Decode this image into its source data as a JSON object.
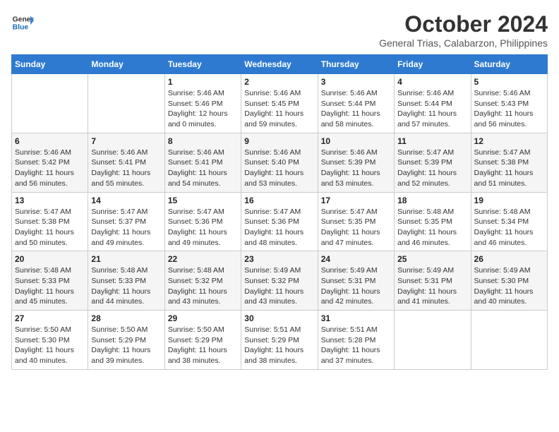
{
  "logo": {
    "text_general": "General",
    "text_blue": "Blue"
  },
  "header": {
    "month": "October 2024",
    "location": "General Trias, Calabarzon, Philippines"
  },
  "weekdays": [
    "Sunday",
    "Monday",
    "Tuesday",
    "Wednesday",
    "Thursday",
    "Friday",
    "Saturday"
  ],
  "weeks": [
    [
      {
        "day": "",
        "sunrise": "",
        "sunset": "",
        "daylight": ""
      },
      {
        "day": "",
        "sunrise": "",
        "sunset": "",
        "daylight": ""
      },
      {
        "day": "1",
        "sunrise": "Sunrise: 5:46 AM",
        "sunset": "Sunset: 5:46 PM",
        "daylight": "Daylight: 12 hours and 0 minutes."
      },
      {
        "day": "2",
        "sunrise": "Sunrise: 5:46 AM",
        "sunset": "Sunset: 5:45 PM",
        "daylight": "Daylight: 11 hours and 59 minutes."
      },
      {
        "day": "3",
        "sunrise": "Sunrise: 5:46 AM",
        "sunset": "Sunset: 5:44 PM",
        "daylight": "Daylight: 11 hours and 58 minutes."
      },
      {
        "day": "4",
        "sunrise": "Sunrise: 5:46 AM",
        "sunset": "Sunset: 5:44 PM",
        "daylight": "Daylight: 11 hours and 57 minutes."
      },
      {
        "day": "5",
        "sunrise": "Sunrise: 5:46 AM",
        "sunset": "Sunset: 5:43 PM",
        "daylight": "Daylight: 11 hours and 56 minutes."
      }
    ],
    [
      {
        "day": "6",
        "sunrise": "Sunrise: 5:46 AM",
        "sunset": "Sunset: 5:42 PM",
        "daylight": "Daylight: 11 hours and 56 minutes."
      },
      {
        "day": "7",
        "sunrise": "Sunrise: 5:46 AM",
        "sunset": "Sunset: 5:41 PM",
        "daylight": "Daylight: 11 hours and 55 minutes."
      },
      {
        "day": "8",
        "sunrise": "Sunrise: 5:46 AM",
        "sunset": "Sunset: 5:41 PM",
        "daylight": "Daylight: 11 hours and 54 minutes."
      },
      {
        "day": "9",
        "sunrise": "Sunrise: 5:46 AM",
        "sunset": "Sunset: 5:40 PM",
        "daylight": "Daylight: 11 hours and 53 minutes."
      },
      {
        "day": "10",
        "sunrise": "Sunrise: 5:46 AM",
        "sunset": "Sunset: 5:39 PM",
        "daylight": "Daylight: 11 hours and 53 minutes."
      },
      {
        "day": "11",
        "sunrise": "Sunrise: 5:47 AM",
        "sunset": "Sunset: 5:39 PM",
        "daylight": "Daylight: 11 hours and 52 minutes."
      },
      {
        "day": "12",
        "sunrise": "Sunrise: 5:47 AM",
        "sunset": "Sunset: 5:38 PM",
        "daylight": "Daylight: 11 hours and 51 minutes."
      }
    ],
    [
      {
        "day": "13",
        "sunrise": "Sunrise: 5:47 AM",
        "sunset": "Sunset: 5:38 PM",
        "daylight": "Daylight: 11 hours and 50 minutes."
      },
      {
        "day": "14",
        "sunrise": "Sunrise: 5:47 AM",
        "sunset": "Sunset: 5:37 PM",
        "daylight": "Daylight: 11 hours and 49 minutes."
      },
      {
        "day": "15",
        "sunrise": "Sunrise: 5:47 AM",
        "sunset": "Sunset: 5:36 PM",
        "daylight": "Daylight: 11 hours and 49 minutes."
      },
      {
        "day": "16",
        "sunrise": "Sunrise: 5:47 AM",
        "sunset": "Sunset: 5:36 PM",
        "daylight": "Daylight: 11 hours and 48 minutes."
      },
      {
        "day": "17",
        "sunrise": "Sunrise: 5:47 AM",
        "sunset": "Sunset: 5:35 PM",
        "daylight": "Daylight: 11 hours and 47 minutes."
      },
      {
        "day": "18",
        "sunrise": "Sunrise: 5:48 AM",
        "sunset": "Sunset: 5:35 PM",
        "daylight": "Daylight: 11 hours and 46 minutes."
      },
      {
        "day": "19",
        "sunrise": "Sunrise: 5:48 AM",
        "sunset": "Sunset: 5:34 PM",
        "daylight": "Daylight: 11 hours and 46 minutes."
      }
    ],
    [
      {
        "day": "20",
        "sunrise": "Sunrise: 5:48 AM",
        "sunset": "Sunset: 5:33 PM",
        "daylight": "Daylight: 11 hours and 45 minutes."
      },
      {
        "day": "21",
        "sunrise": "Sunrise: 5:48 AM",
        "sunset": "Sunset: 5:33 PM",
        "daylight": "Daylight: 11 hours and 44 minutes."
      },
      {
        "day": "22",
        "sunrise": "Sunrise: 5:48 AM",
        "sunset": "Sunset: 5:32 PM",
        "daylight": "Daylight: 11 hours and 43 minutes."
      },
      {
        "day": "23",
        "sunrise": "Sunrise: 5:49 AM",
        "sunset": "Sunset: 5:32 PM",
        "daylight": "Daylight: 11 hours and 43 minutes."
      },
      {
        "day": "24",
        "sunrise": "Sunrise: 5:49 AM",
        "sunset": "Sunset: 5:31 PM",
        "daylight": "Daylight: 11 hours and 42 minutes."
      },
      {
        "day": "25",
        "sunrise": "Sunrise: 5:49 AM",
        "sunset": "Sunset: 5:31 PM",
        "daylight": "Daylight: 11 hours and 41 minutes."
      },
      {
        "day": "26",
        "sunrise": "Sunrise: 5:49 AM",
        "sunset": "Sunset: 5:30 PM",
        "daylight": "Daylight: 11 hours and 40 minutes."
      }
    ],
    [
      {
        "day": "27",
        "sunrise": "Sunrise: 5:50 AM",
        "sunset": "Sunset: 5:30 PM",
        "daylight": "Daylight: 11 hours and 40 minutes."
      },
      {
        "day": "28",
        "sunrise": "Sunrise: 5:50 AM",
        "sunset": "Sunset: 5:29 PM",
        "daylight": "Daylight: 11 hours and 39 minutes."
      },
      {
        "day": "29",
        "sunrise": "Sunrise: 5:50 AM",
        "sunset": "Sunset: 5:29 PM",
        "daylight": "Daylight: 11 hours and 38 minutes."
      },
      {
        "day": "30",
        "sunrise": "Sunrise: 5:51 AM",
        "sunset": "Sunset: 5:29 PM",
        "daylight": "Daylight: 11 hours and 38 minutes."
      },
      {
        "day": "31",
        "sunrise": "Sunrise: 5:51 AM",
        "sunset": "Sunset: 5:28 PM",
        "daylight": "Daylight: 11 hours and 37 minutes."
      },
      {
        "day": "",
        "sunrise": "",
        "sunset": "",
        "daylight": ""
      },
      {
        "day": "",
        "sunrise": "",
        "sunset": "",
        "daylight": ""
      }
    ]
  ]
}
